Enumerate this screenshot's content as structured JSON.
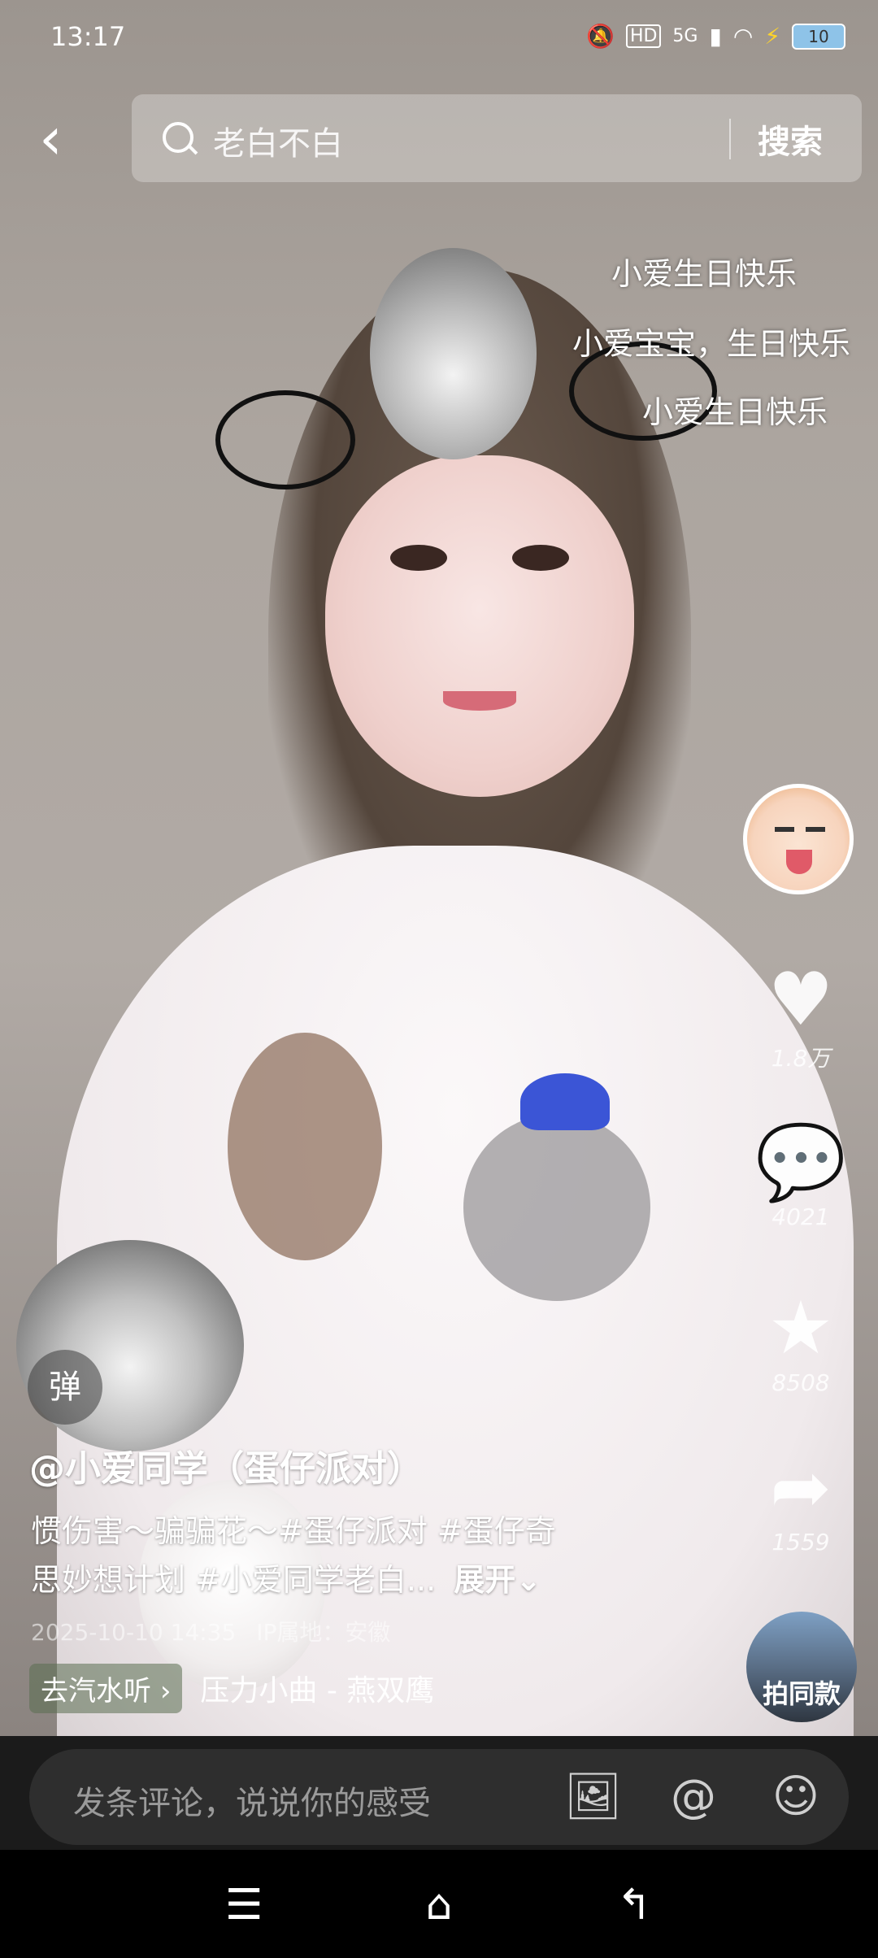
{
  "status_bar": {
    "time": "13:17",
    "network": "5G",
    "hd_label": "HD",
    "battery": "10"
  },
  "search": {
    "query": "老白不白",
    "button_label": "搜索"
  },
  "danmaku": [
    "小爱生日快乐",
    "小爱宝宝，生日快乐",
    "小爱生日快乐"
  ],
  "actions": {
    "like_count": "1.8万",
    "comment_count": "4021",
    "favorite_count": "8508",
    "share_count": "1559"
  },
  "video_info": {
    "danmaku_toggle": "弹",
    "author": "@小爱同学（蛋仔派对）",
    "description_line1": "惯伤害～骗骗花～#蛋仔派对 #蛋仔奇",
    "description_line2": "思妙想计划 #小爱同学老白...",
    "expand_label": "展开",
    "timestamp": "2025-10-10 14:35",
    "ip_location": "IP属地：安徽",
    "music_chip": "去汽水听",
    "music_title": "压力小曲 - 燕双鹰",
    "same_style_label": "拍同款"
  },
  "comment_bar": {
    "placeholder": "发条评论，说说你的感受"
  }
}
